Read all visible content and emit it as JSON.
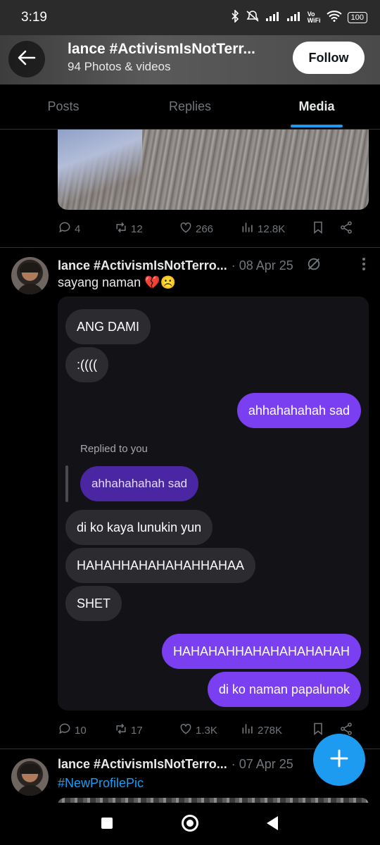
{
  "status_bar": {
    "time": "3:19",
    "battery": "100"
  },
  "header": {
    "title": "lance #ActivismIsNotTerr...",
    "subtitle": "94 Photos & videos",
    "follow_label": "Follow"
  },
  "tabs": [
    {
      "label": "Posts",
      "active": false
    },
    {
      "label": "Replies",
      "active": false
    },
    {
      "label": "Media",
      "active": true
    }
  ],
  "post1_actions": {
    "replies": "4",
    "reposts": "12",
    "likes": "266",
    "views": "12.8K"
  },
  "post2": {
    "name": "lance #ActivismIsNotTerro...",
    "date": "· 08 Apr 25",
    "text": "sayang naman 💔☹️",
    "chat": {
      "m1": "ANG DAMI",
      "m2": ":((((",
      "m3": "ahhahahahah sad",
      "replied_label": "Replied to you",
      "m4": "ahhahahahah sad",
      "m5": "di ko kaya lunukin yun",
      "m6": "HAHAHHAHAHAHAHHAHAA",
      "m7": "SHET",
      "m8": "HAHAHAHHAHAHAHAHAHAH",
      "m9": "di ko naman papalunok"
    },
    "actions": {
      "replies": "10",
      "reposts": "17",
      "likes": "1.3K",
      "views": "278K"
    }
  },
  "post3": {
    "name": "lance #ActivismIsNotTerro...",
    "date": "· 07 Apr 25",
    "text": "#NewProfilePic"
  },
  "colors": {
    "accent": "#1d9bf0",
    "chat_me": "#7b3ff2",
    "chat_them": "#2b2b30"
  }
}
